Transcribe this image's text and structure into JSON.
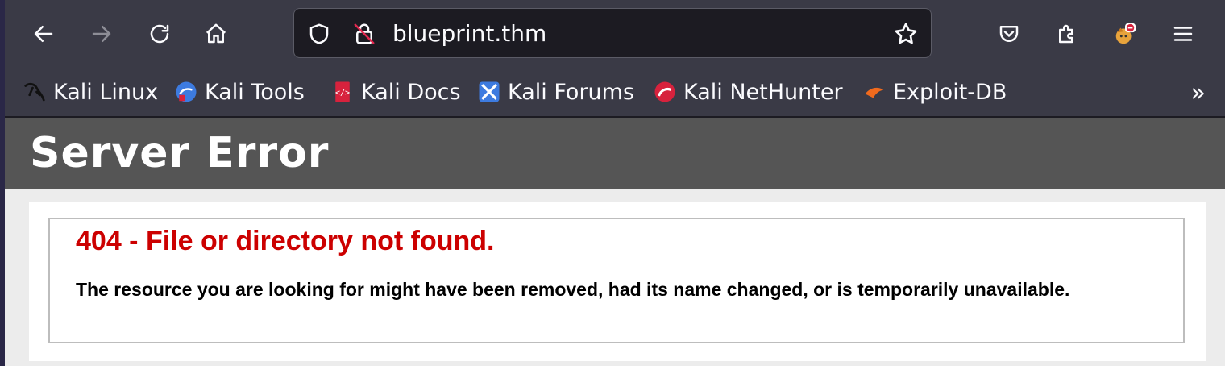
{
  "browser": {
    "url": "blueprint.thm",
    "bookmarks": [
      {
        "label": "Kali Linux",
        "icon": "kali-dragon-icon"
      },
      {
        "label": "Kali Tools",
        "icon": "kali-tools-icon"
      },
      {
        "label": "Kali Docs",
        "icon": "kali-docs-icon"
      },
      {
        "label": "Kali Forums",
        "icon": "kali-forums-icon"
      },
      {
        "label": "Kali NetHunter",
        "icon": "kali-nethunter-icon"
      },
      {
        "label": "Exploit-DB",
        "icon": "exploit-db-icon"
      }
    ],
    "more_glyph": "»"
  },
  "page": {
    "header": "Server Error",
    "error_title": "404 - File or directory not found.",
    "error_message": "The resource you are looking for might have been removed, had its name changed, or is temporarily unavailable."
  },
  "colors": {
    "toolbar": "#3a3a46",
    "header_bg": "#555555",
    "error_red": "#cc0000"
  }
}
